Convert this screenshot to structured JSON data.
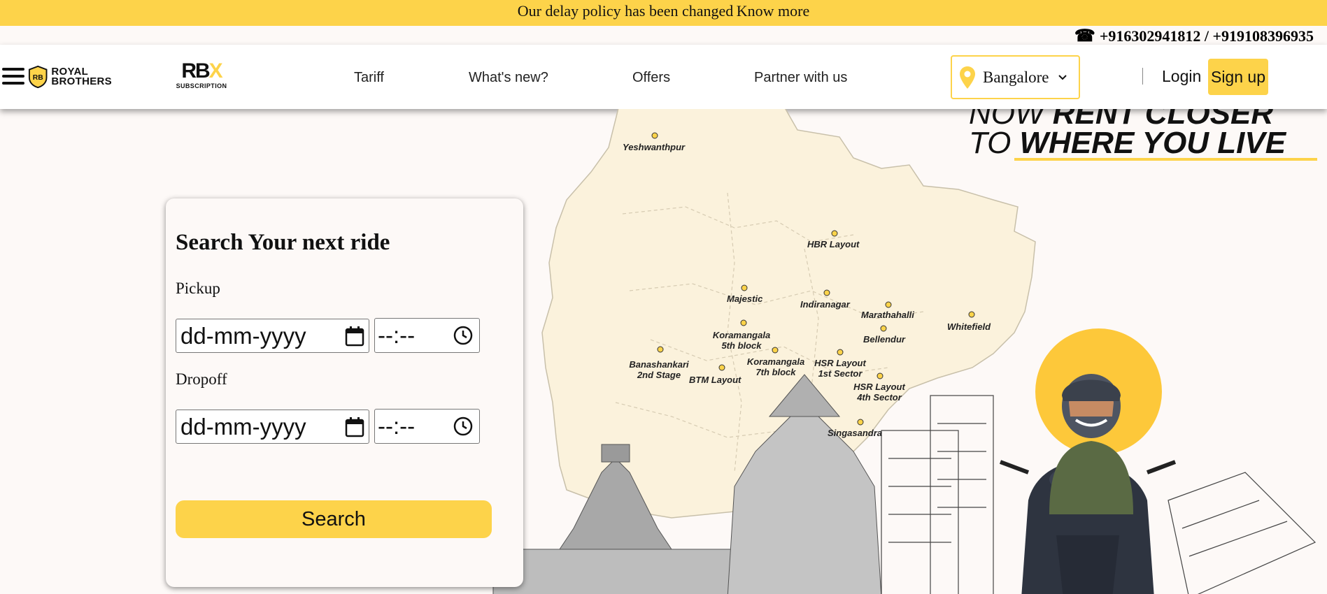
{
  "banner": {
    "message": "Our delay policy has been changed",
    "link": "Know more"
  },
  "contact": {
    "phones": "+916302941812 / +919108396935"
  },
  "header": {
    "brand": "ROYAL\nBROTHERS",
    "brand_line1": "ROYAL",
    "brand_line2": "BROTHERS",
    "rbx_main_a": "RB",
    "rbx_main_b": "X",
    "rbx_sub": "SUBSCRIPTION",
    "nav": [
      "Tariff",
      "What's new?",
      "Offers",
      "Partner with us"
    ],
    "city": "Bangalore",
    "login": "Login",
    "signup": "Sign up"
  },
  "hero": {
    "tagline_line1_thin": "NOW ",
    "tagline_line1_bold": "RENT CLOSER",
    "tagline_line2_thin": "TO ",
    "tagline_line2_bold": "WHERE YOU LIVE",
    "locations": [
      "Yeshwanthpur",
      "HBR Layout",
      "Majestic",
      "Indiranagar",
      "Marathahalli",
      "Whitefield",
      "Koramangala 5th block",
      "Bellendur",
      "Banashankari 2nd Stage",
      "Koramangala 7th block",
      "HSR Layout 1st Sector",
      "BTM Layout",
      "HSR Layout 4th Sector",
      "Singasandra"
    ]
  },
  "search_form": {
    "title": "Search Your next ride",
    "pickup_label": "Pickup",
    "dropoff_label": "Dropoff",
    "date_placeholder": "dd-mm-yyyy",
    "time_placeholder": "--:--",
    "search_button": "Search"
  },
  "colors": {
    "accent": "#fdd34a",
    "map_fill": "#fbf2dc",
    "background": "#fdf9f7"
  },
  "icons": [
    "phone-icon",
    "hamburger-icon",
    "map-pin-icon",
    "chevron-down-icon",
    "calendar-icon",
    "clock-icon"
  ]
}
